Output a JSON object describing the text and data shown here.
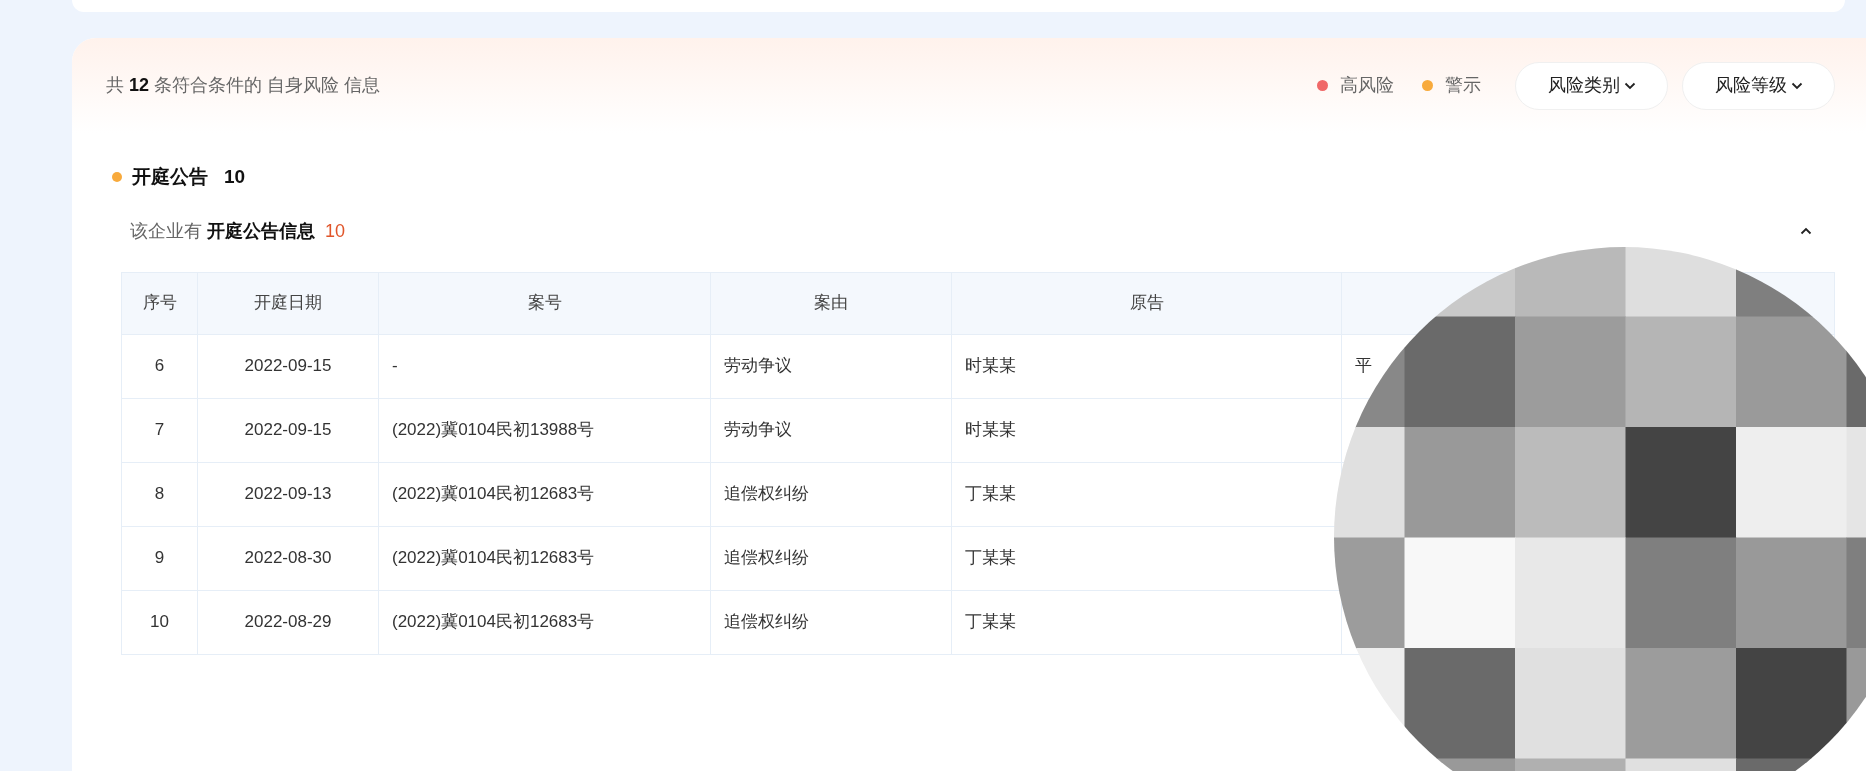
{
  "summary": {
    "prefix": "共",
    "count": "12",
    "middle": "条符合条件的",
    "category": "自身风险",
    "suffix": "信息"
  },
  "legend": [
    {
      "label": "高风险",
      "color": "#f06868"
    },
    {
      "label": "警示",
      "color": "#f8aa3c"
    }
  ],
  "filters": [
    {
      "label": "风险类别"
    },
    {
      "label": "风险等级"
    }
  ],
  "section": {
    "title": "开庭公告",
    "count": "10",
    "color": "#f8aa3c",
    "expanded": true,
    "subtitle": "该企业有 **开庭公告信息**",
    "subtitle_count": "10"
  },
  "table": {
    "columns": [
      "序号",
      "开庭日期",
      "案号",
      "案由",
      "原告"
    ],
    "rows": [
      [
        "6",
        "2022-09-15",
        "-",
        "劳动争议",
        "时某某",
        "平"
      ],
      [
        "7",
        "2022-09-15",
        "(2022)冀0104民初13988号",
        "劳动争议",
        "时某某"
      ],
      [
        "8",
        "2022-09-13",
        "(2022)冀0104民初12683号",
        "追偿权纠纷",
        "丁某某"
      ],
      [
        "9",
        "2022-08-30",
        "(2022)冀0104民初12683号",
        "追偿权纠纷",
        "丁某某"
      ],
      [
        "10",
        "2022-08-29",
        "(2022)冀0104民初12683号",
        "追偿权纠纷",
        "丁某某"
      ]
    ]
  }
}
